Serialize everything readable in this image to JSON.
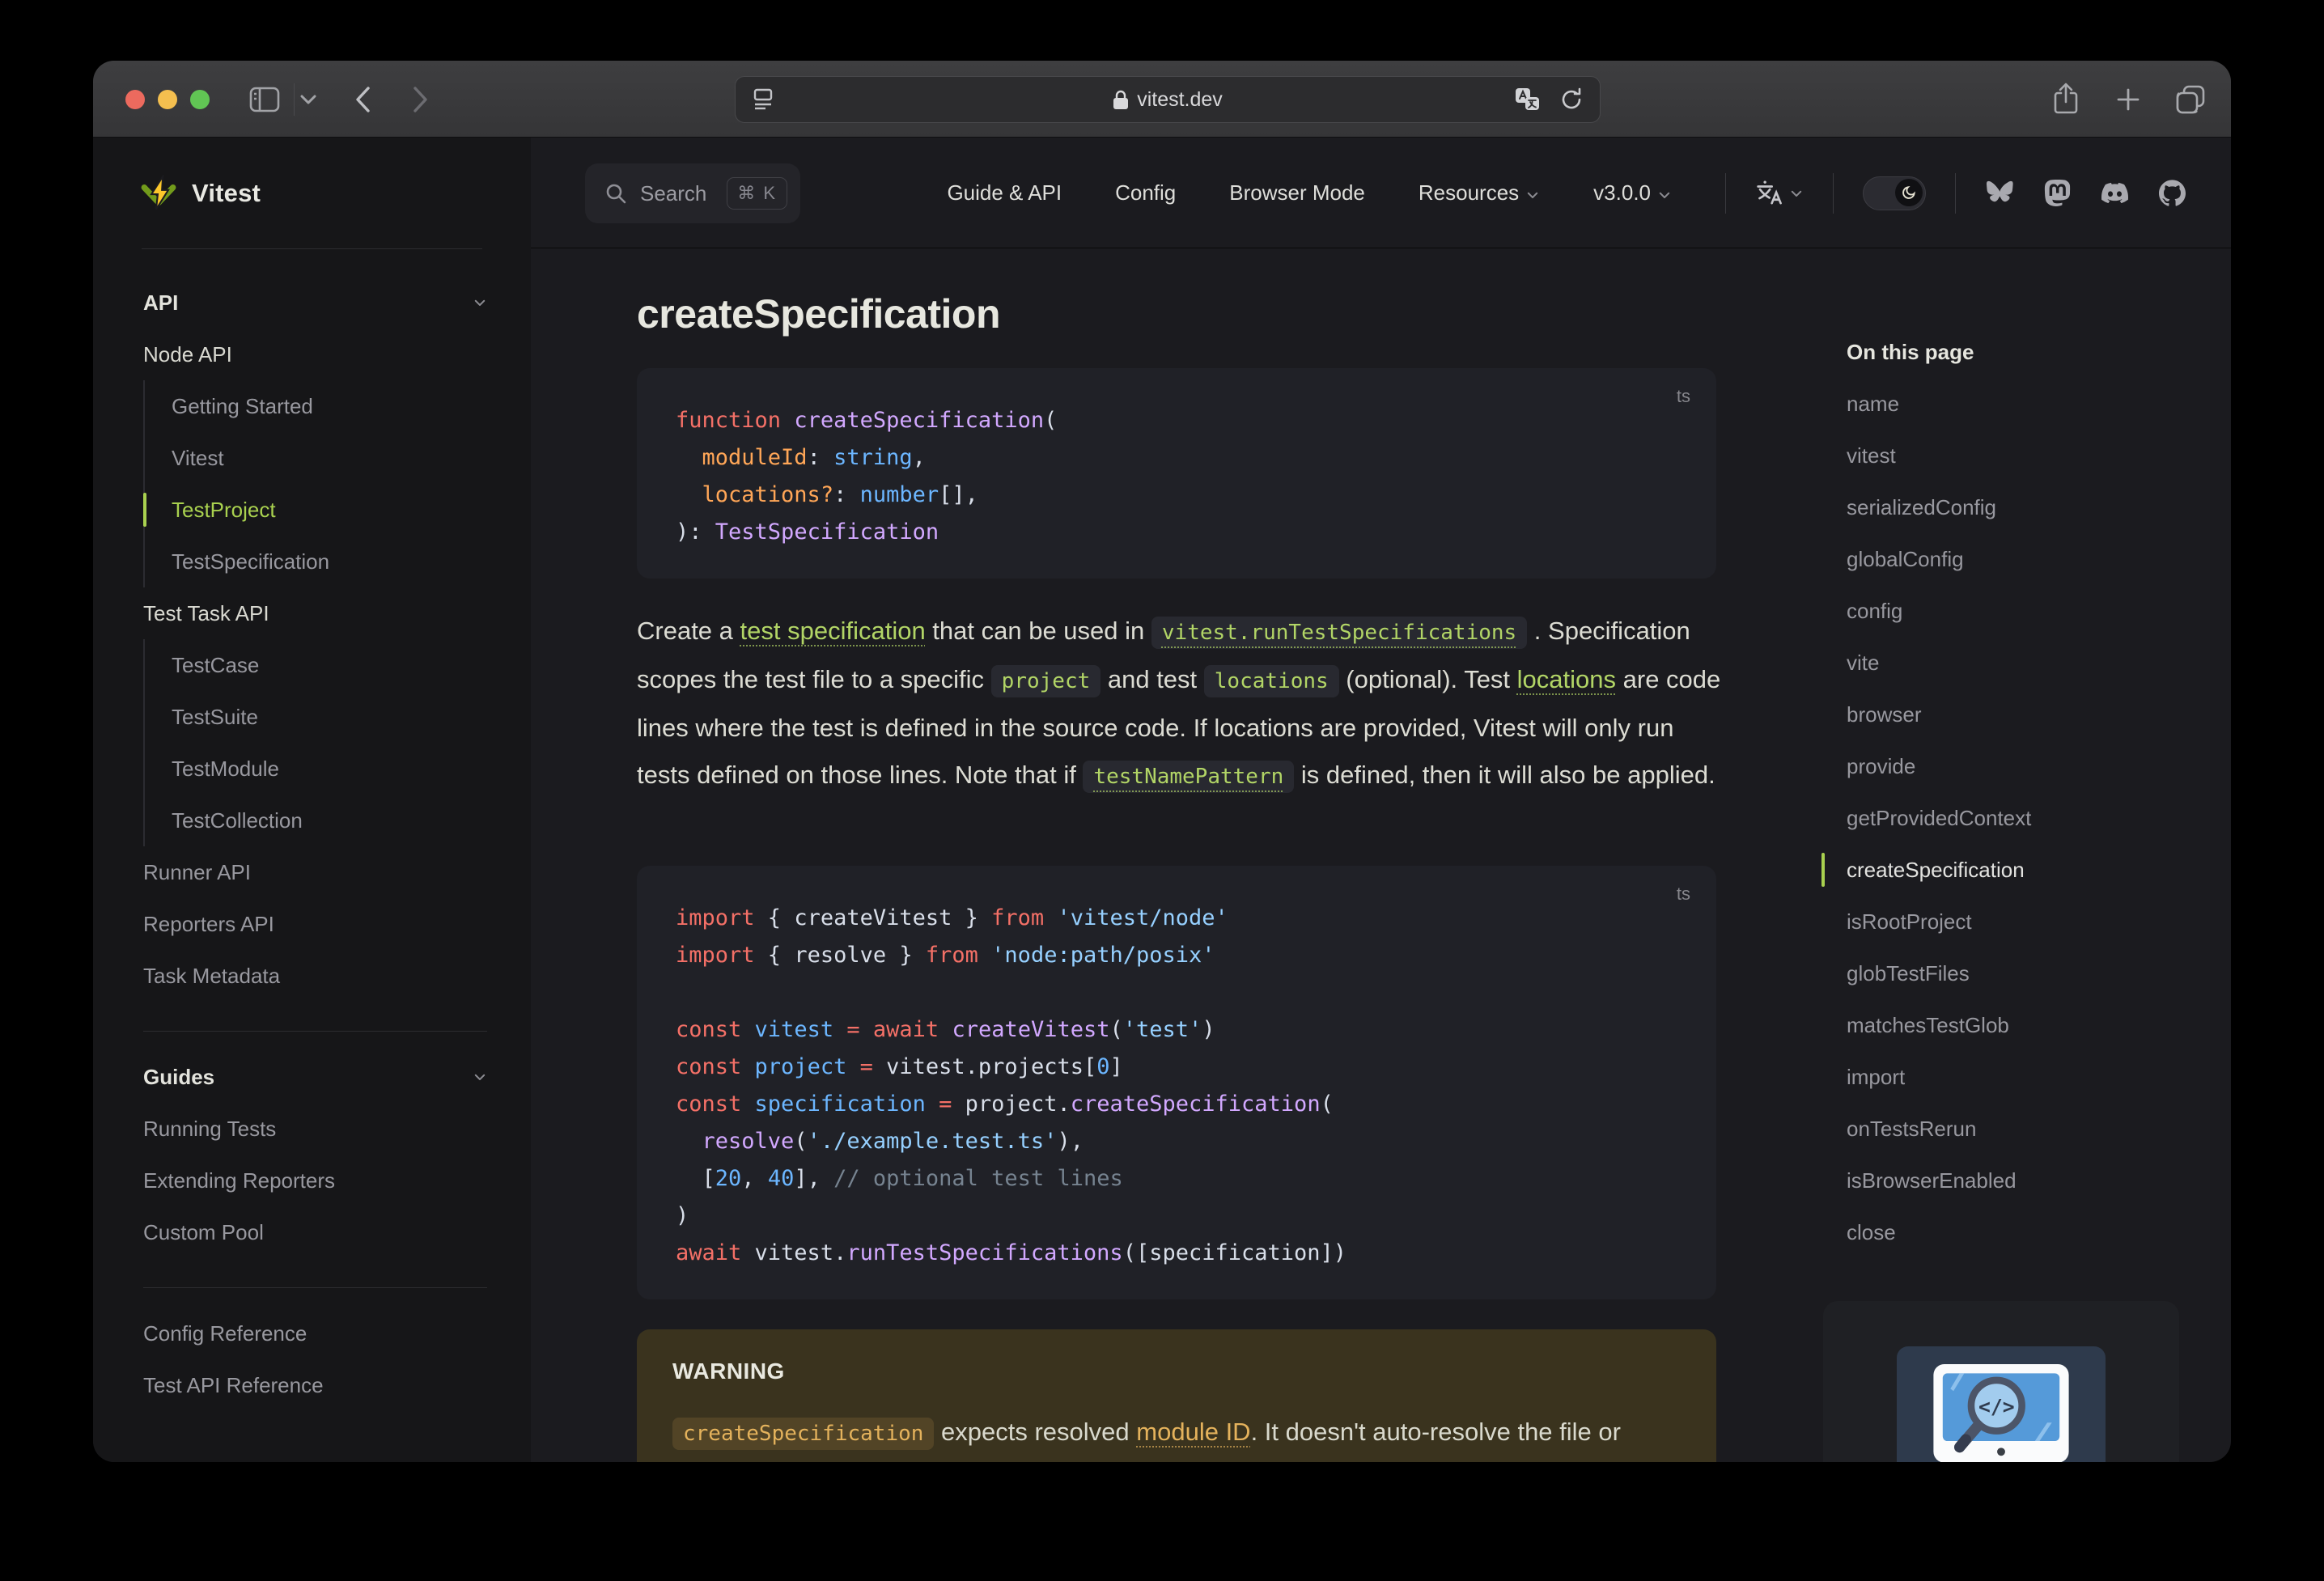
{
  "browser_chrome": {
    "url": "vitest.dev",
    "traffic_lights": [
      "close",
      "minimize",
      "zoom"
    ],
    "left_icons": [
      "sidebar-toggle",
      "tab-group-chevron",
      "back",
      "forward"
    ],
    "urlbar_icons": [
      "reader",
      "lock",
      "translate",
      "reload"
    ],
    "right_icons": [
      "share",
      "new-tab",
      "tab-overview"
    ]
  },
  "sidebar": {
    "logo_text": "Vitest",
    "groups": [
      {
        "title": "API",
        "children": [
          {
            "label": "Node API",
            "kind": "section"
          },
          {
            "label": "Getting Started",
            "kind": "sub"
          },
          {
            "label": "Vitest",
            "kind": "sub"
          },
          {
            "label": "TestProject",
            "kind": "sub",
            "active": true
          },
          {
            "label": "TestSpecification",
            "kind": "sub"
          },
          {
            "label": "Test Task API",
            "kind": "section"
          },
          {
            "label": "TestCase",
            "kind": "sub"
          },
          {
            "label": "TestSuite",
            "kind": "sub"
          },
          {
            "label": "TestModule",
            "kind": "sub"
          },
          {
            "label": "TestCollection",
            "kind": "sub"
          },
          {
            "label": "Runner API",
            "kind": "link"
          },
          {
            "label": "Reporters API",
            "kind": "link"
          },
          {
            "label": "Task Metadata",
            "kind": "link"
          }
        ]
      },
      {
        "title": "Guides",
        "children": [
          {
            "label": "Running Tests",
            "kind": "link"
          },
          {
            "label": "Extending Reporters",
            "kind": "link"
          },
          {
            "label": "Custom Pool",
            "kind": "link"
          }
        ]
      },
      {
        "title": null,
        "children": [
          {
            "label": "Config Reference",
            "kind": "link"
          },
          {
            "label": "Test API Reference",
            "kind": "link"
          }
        ]
      }
    ]
  },
  "nav": {
    "search": {
      "label": "Search",
      "shortcut": "⌘ K"
    },
    "links": [
      {
        "label": "Guide & API",
        "dropdown": false
      },
      {
        "label": "Config",
        "dropdown": false
      },
      {
        "label": "Browser Mode",
        "dropdown": false
      },
      {
        "label": "Resources",
        "dropdown": true
      },
      {
        "label": "v3.0.0",
        "dropdown": true
      }
    ],
    "socials": [
      "bluesky",
      "mastodon",
      "discord",
      "github"
    ],
    "theme_toggle": "dark"
  },
  "content": {
    "heading": "createSpecification",
    "code_blocks": [
      {
        "lang": "ts",
        "lines": [
          [
            [
              "k",
              "function"
            ],
            [
              "p",
              " "
            ],
            [
              "f",
              "createSpecification"
            ],
            [
              "p",
              "("
            ]
          ],
          [
            [
              "p",
              "  "
            ],
            [
              "v",
              "moduleId"
            ],
            [
              "p",
              ": "
            ],
            [
              "t",
              "string"
            ],
            [
              "p",
              ","
            ]
          ],
          [
            [
              "p",
              "  "
            ],
            [
              "v",
              "locations?"
            ],
            [
              "p",
              ": "
            ],
            [
              "t",
              "number"
            ],
            [
              "p",
              "[],"
            ]
          ],
          [
            [
              "p",
              "): "
            ],
            [
              "f",
              "TestSpecification"
            ]
          ]
        ]
      },
      {
        "lang": "ts",
        "lines": [
          [
            [
              "k",
              "import"
            ],
            [
              "p",
              " { createVitest } "
            ],
            [
              "k",
              "from"
            ],
            [
              "p",
              " "
            ],
            [
              "s",
              "'vitest/node'"
            ]
          ],
          [
            [
              "k",
              "import"
            ],
            [
              "p",
              " { resolve } "
            ],
            [
              "k",
              "from"
            ],
            [
              "p",
              " "
            ],
            [
              "s",
              "'node:path/posix'"
            ]
          ],
          [],
          [
            [
              "k",
              "const"
            ],
            [
              "p",
              " "
            ],
            [
              "t",
              "vitest"
            ],
            [
              "p",
              " "
            ],
            [
              "k",
              "="
            ],
            [
              "p",
              " "
            ],
            [
              "k",
              "await"
            ],
            [
              "p",
              " "
            ],
            [
              "f",
              "createVitest"
            ],
            [
              "p",
              "("
            ],
            [
              "s",
              "'test'"
            ],
            [
              "p",
              ")"
            ]
          ],
          [
            [
              "k",
              "const"
            ],
            [
              "p",
              " "
            ],
            [
              "t",
              "project"
            ],
            [
              "p",
              " "
            ],
            [
              "k",
              "="
            ],
            [
              "p",
              " vitest.projects["
            ],
            [
              "n",
              "0"
            ],
            [
              "p",
              "]"
            ]
          ],
          [
            [
              "k",
              "const"
            ],
            [
              "p",
              " "
            ],
            [
              "t",
              "specification"
            ],
            [
              "p",
              " "
            ],
            [
              "k",
              "="
            ],
            [
              "p",
              " project."
            ],
            [
              "f",
              "createSpecification"
            ],
            [
              "p",
              "("
            ]
          ],
          [
            [
              "p",
              "  "
            ],
            [
              "f",
              "resolve"
            ],
            [
              "p",
              "("
            ],
            [
              "s",
              "'./example.test.ts'"
            ],
            [
              "p",
              "),"
            ]
          ],
          [
            [
              "p",
              "  ["
            ],
            [
              "n",
              "20"
            ],
            [
              "p",
              ", "
            ],
            [
              "n",
              "40"
            ],
            [
              "p",
              "], "
            ],
            [
              "c",
              "// optional test lines"
            ]
          ],
          [
            [
              "p",
              ")"
            ]
          ],
          [
            [
              "k",
              "await"
            ],
            [
              "p",
              " vitest."
            ],
            [
              "f",
              "runTestSpecifications"
            ],
            [
              "p",
              "([specification])"
            ]
          ]
        ]
      }
    ],
    "paragraph_runs": [
      {
        "t": "Create a "
      },
      {
        "t": "test specification",
        "type": "link"
      },
      {
        "t": " that can be used in "
      },
      {
        "t": "vitest.runTestSpecifications",
        "type": "codelink"
      },
      {
        "t": " . Specification scopes the test file to a specific "
      },
      {
        "t": "project",
        "type": "code"
      },
      {
        "t": " and test "
      },
      {
        "t": "locations",
        "type": "code"
      },
      {
        "t": " (optional). Test "
      },
      {
        "t": "locations",
        "type": "link"
      },
      {
        "t": " are code lines where the test is defined in the source code. If locations are provided, Vitest will only run tests defined on those lines. Note that if "
      },
      {
        "t": "testNamePattern",
        "type": "codelink"
      },
      {
        "t": " is defined, then it will also be applied."
      }
    ],
    "warning": {
      "title": "WARNING",
      "runs": [
        {
          "t": "createSpecification",
          "type": "code-warn"
        },
        {
          "t": " expects resolved "
        },
        {
          "t": "module ID",
          "type": "link-warn"
        },
        {
          "t": ". It doesn't auto-resolve the file or check that it exists on the file system."
        }
      ]
    }
  },
  "toc": {
    "heading": "On this page",
    "items": [
      "name",
      "vitest",
      "serializedConfig",
      "globalConfig",
      "config",
      "vite",
      "browser",
      "provide",
      "getProvidedContext",
      "createSpecification",
      "isRootProject",
      "globTestFiles",
      "matchesTestGlob",
      "import",
      "onTestsRerun",
      "isBrowserEnabled",
      "close"
    ],
    "active": "createSpecification"
  },
  "colors": {
    "brand_green": "#a9d14f",
    "link_green": "#b2d566",
    "warning_bg": "#3a331e",
    "warning_accent": "#e4b25c",
    "page_bg": "#1b1b1f",
    "sidebar_bg": "#161618",
    "code_bg": "#202127"
  }
}
